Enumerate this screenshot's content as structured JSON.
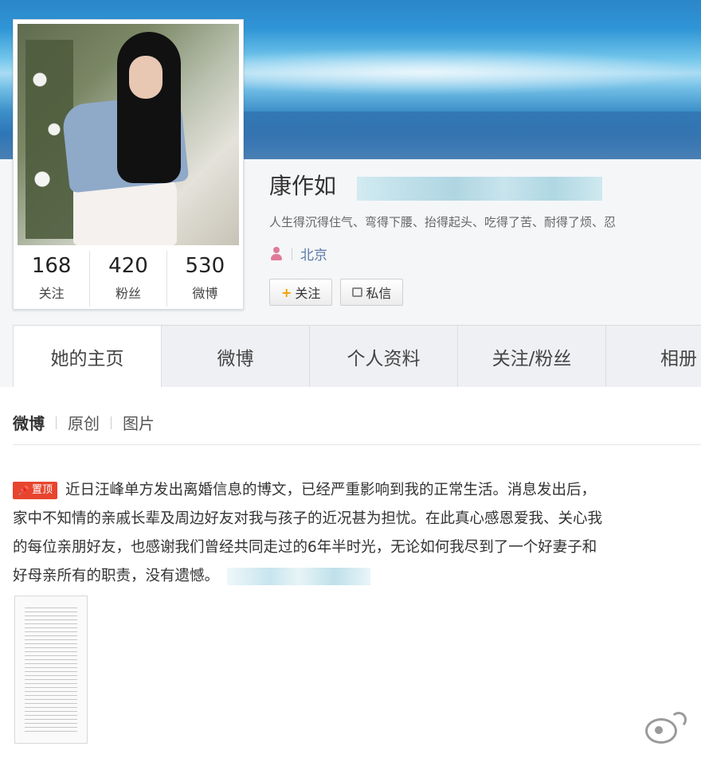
{
  "profile": {
    "name": "康作如",
    "bio": "人生得沉得住气、弯得下腰、抬得起头、吃得了苦、耐得了烦、忍",
    "location": "北京",
    "stats": [
      {
        "value": "168",
        "label": "关注"
      },
      {
        "value": "420",
        "label": "粉丝"
      },
      {
        "value": "530",
        "label": "微博"
      }
    ],
    "follow_label": "关注",
    "message_label": "私信"
  },
  "tabs": [
    "她的主页",
    "微博",
    "个人资料",
    "关注/粉丝",
    "相册"
  ],
  "filters": [
    "微博",
    "原创",
    "图片"
  ],
  "post": {
    "badge": "置顶",
    "lines": [
      "近日汪峰单方发出离婚信息的博文，已经严重影响到我的正常生活。消息发出后，",
      "家中不知情的亲戚长辈及周边好友对我与孩子的近况甚为担忧。在此真心感恩爱我、关心我",
      "的每位亲朋好友，也感谢我们曾经共同走过的6年半时光，无论如何我尽到了一个好妻子和",
      "好母亲所有的职责，没有遗憾。"
    ]
  },
  "icons": {
    "pin": "pin-icon",
    "location": "person-icon",
    "follow": "plus-icon",
    "message": "message-icon",
    "watermark": "weibo-logo-icon"
  },
  "colors": {
    "badge": "#e8452e",
    "link": "#5b7aa8",
    "follow_plus": "#f0a000"
  }
}
